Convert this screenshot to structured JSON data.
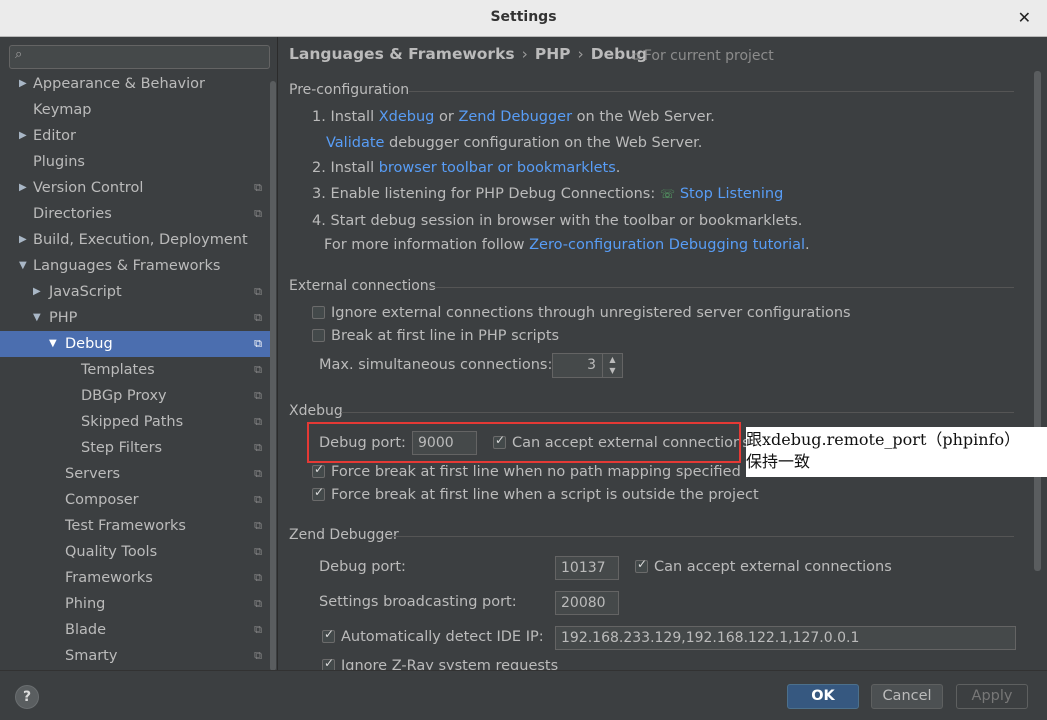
{
  "window": {
    "title": "Settings",
    "close_glyph": "✕"
  },
  "search": {
    "placeholder": "",
    "icon": "search-icon"
  },
  "tree": [
    {
      "label": "Appearance & Behavior",
      "arrow": "▶",
      "level": 0,
      "proj": false
    },
    {
      "label": "Keymap",
      "arrow": "",
      "level": 0,
      "proj": false
    },
    {
      "label": "Editor",
      "arrow": "▶",
      "level": 0,
      "proj": false
    },
    {
      "label": "Plugins",
      "arrow": "",
      "level": 0,
      "proj": false
    },
    {
      "label": "Version Control",
      "arrow": "▶",
      "level": 0,
      "proj": true
    },
    {
      "label": "Directories",
      "arrow": "",
      "level": 0,
      "proj": true
    },
    {
      "label": "Build, Execution, Deployment",
      "arrow": "▶",
      "level": 0,
      "proj": false
    },
    {
      "label": "Languages & Frameworks",
      "arrow": "▼",
      "level": 0,
      "proj": false
    },
    {
      "label": "JavaScript",
      "arrow": "▶",
      "level": 1,
      "proj": true
    },
    {
      "label": "PHP",
      "arrow": "▼",
      "level": 1,
      "proj": true
    },
    {
      "label": "Debug",
      "arrow": "▼",
      "level": 2,
      "proj": true,
      "selected": true
    },
    {
      "label": "Templates",
      "arrow": "",
      "level": 3,
      "proj": true
    },
    {
      "label": "DBGp Proxy",
      "arrow": "",
      "level": 3,
      "proj": true
    },
    {
      "label": "Skipped Paths",
      "arrow": "",
      "level": 3,
      "proj": true
    },
    {
      "label": "Step Filters",
      "arrow": "",
      "level": 3,
      "proj": true
    },
    {
      "label": "Servers",
      "arrow": "",
      "level": 2,
      "proj": true
    },
    {
      "label": "Composer",
      "arrow": "",
      "level": 2,
      "proj": true
    },
    {
      "label": "Test Frameworks",
      "arrow": "",
      "level": 2,
      "proj": true
    },
    {
      "label": "Quality Tools",
      "arrow": "",
      "level": 2,
      "proj": true
    },
    {
      "label": "Frameworks",
      "arrow": "",
      "level": 2,
      "proj": true
    },
    {
      "label": "Phing",
      "arrow": "",
      "level": 2,
      "proj": true
    },
    {
      "label": "Blade",
      "arrow": "",
      "level": 2,
      "proj": true
    },
    {
      "label": "Smarty",
      "arrow": "",
      "level": 2,
      "proj": true
    }
  ],
  "breadcrumb": {
    "parts": [
      "Languages & Frameworks",
      "PHP",
      "Debug"
    ],
    "sep": "›",
    "for_project": "For current project"
  },
  "preconfig": {
    "title": "Pre-configuration",
    "s1_prefix": "1. Install ",
    "s1_xdebug": "Xdebug",
    "s1_or": " or ",
    "s1_zend": "Zend Debugger",
    "s1_suffix": " on the Web Server.",
    "s1b_link": "Validate",
    "s1b_suffix": " debugger configuration on the Web Server.",
    "s2_prefix": "2. Install ",
    "s2_link": "browser toolbar or bookmarklets",
    "s2_suffix": ".",
    "s3_prefix": "3. Enable listening for PHP Debug Connections:",
    "s3_link": "Stop Listening",
    "s4": "4. Start debug session in browser with the toolbar or bookmarklets.",
    "s4b_prefix": "For more information follow ",
    "s4b_link": "Zero-configuration Debugging tutorial",
    "s4b_suffix": "."
  },
  "external": {
    "title": "External connections",
    "ignore_label": "Ignore external connections through unregistered server configurations",
    "ignore_checked": false,
    "break_label": "Break at first line in PHP scripts",
    "break_checked": false,
    "max_label": "Max. simultaneous connections:",
    "max_value": "3"
  },
  "xdebug": {
    "title": "Xdebug",
    "port_label": "Debug port:",
    "port_value": "9000",
    "accept_label": "Can accept external connections",
    "accept_checked": true,
    "force_no_path": "Force break at first line when no path mapping specified",
    "force_no_path_checked": true,
    "force_outside": "Force break at first line when a script is outside the project",
    "force_outside_checked": true
  },
  "zend": {
    "title": "Zend Debugger",
    "port_label": "Debug port:",
    "port_value": "10137",
    "accept_label": "Can accept external connections",
    "accept_checked": true,
    "broadcast_label": "Settings broadcasting port:",
    "broadcast_value": "20080",
    "detect_label": "Automatically detect IDE IP:",
    "detect_checked": true,
    "detect_value": "192.168.233.129,192.168.122.1,127.0.0.1",
    "ignore_zray": "Ignore Z-Ray system requests",
    "ignore_zray_checked": true
  },
  "annotation": {
    "line1": "跟xdebug.remote_port（phpinfo）",
    "line2": "保持一致"
  },
  "buttons": {
    "help": "?",
    "ok": "OK",
    "cancel": "Cancel",
    "apply": "Apply"
  }
}
